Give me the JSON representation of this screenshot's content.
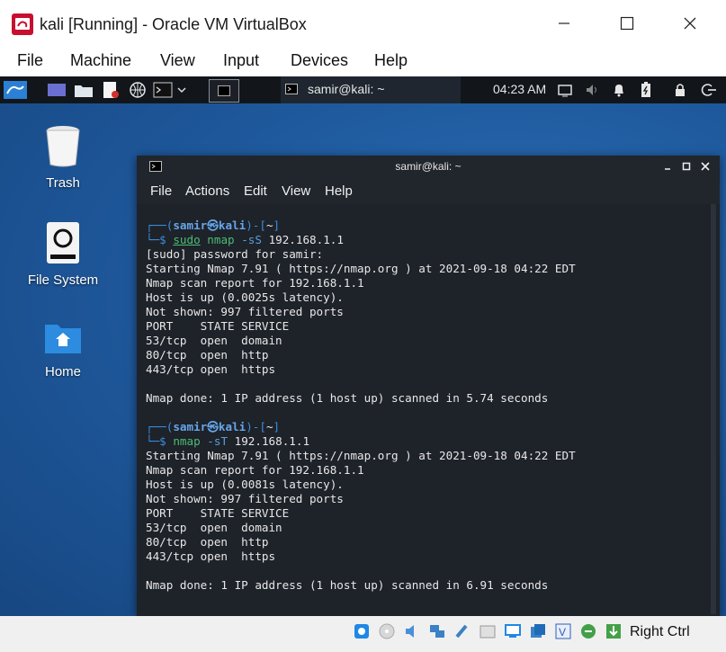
{
  "window": {
    "title": "kali [Running] - Oracle VM VirtualBox",
    "menu": [
      "File",
      "Machine",
      "View",
      "Input",
      "Devices",
      "Help"
    ],
    "accent": "#2d6fb8"
  },
  "panel": {
    "task_label": "samir@kali: ~",
    "clock": "04:23 AM"
  },
  "desktop": {
    "icons": [
      "Trash",
      "File System",
      "Home"
    ]
  },
  "terminal": {
    "title": "samir@kali: ~",
    "menu": [
      "File",
      "Actions",
      "Edit",
      "View",
      "Help"
    ],
    "prompt_user": "samir",
    "prompt_host": "kali",
    "prompt_dir": "~",
    "cmd1": {
      "sudo": "sudo",
      "prog": "nmap",
      "flag": "-sS",
      "target": "192.168.1.1"
    },
    "cmd2": {
      "prog": "nmap",
      "flag": "-sT",
      "target": "192.168.1.1"
    },
    "output1": [
      "[sudo] password for samir:",
      "Starting Nmap 7.91 ( https://nmap.org ) at 2021-09-18 04:22 EDT",
      "Nmap scan report for 192.168.1.1",
      "Host is up (0.0025s latency).",
      "Not shown: 997 filtered ports",
      "PORT    STATE SERVICE",
      "53/tcp  open  domain",
      "80/tcp  open  http",
      "443/tcp open  https",
      "",
      "Nmap done: 1 IP address (1 host up) scanned in 5.74 seconds"
    ],
    "output2": [
      "Starting Nmap 7.91 ( https://nmap.org ) at 2021-09-18 04:22 EDT",
      "Nmap scan report for 192.168.1.1",
      "Host is up (0.0081s latency).",
      "Not shown: 997 filtered ports",
      "PORT    STATE SERVICE",
      "53/tcp  open  domain",
      "80/tcp  open  http",
      "443/tcp open  https",
      "",
      "Nmap done: 1 IP address (1 host up) scanned in 6.91 seconds"
    ]
  },
  "statusbar": {
    "host_key": "Right Ctrl"
  }
}
